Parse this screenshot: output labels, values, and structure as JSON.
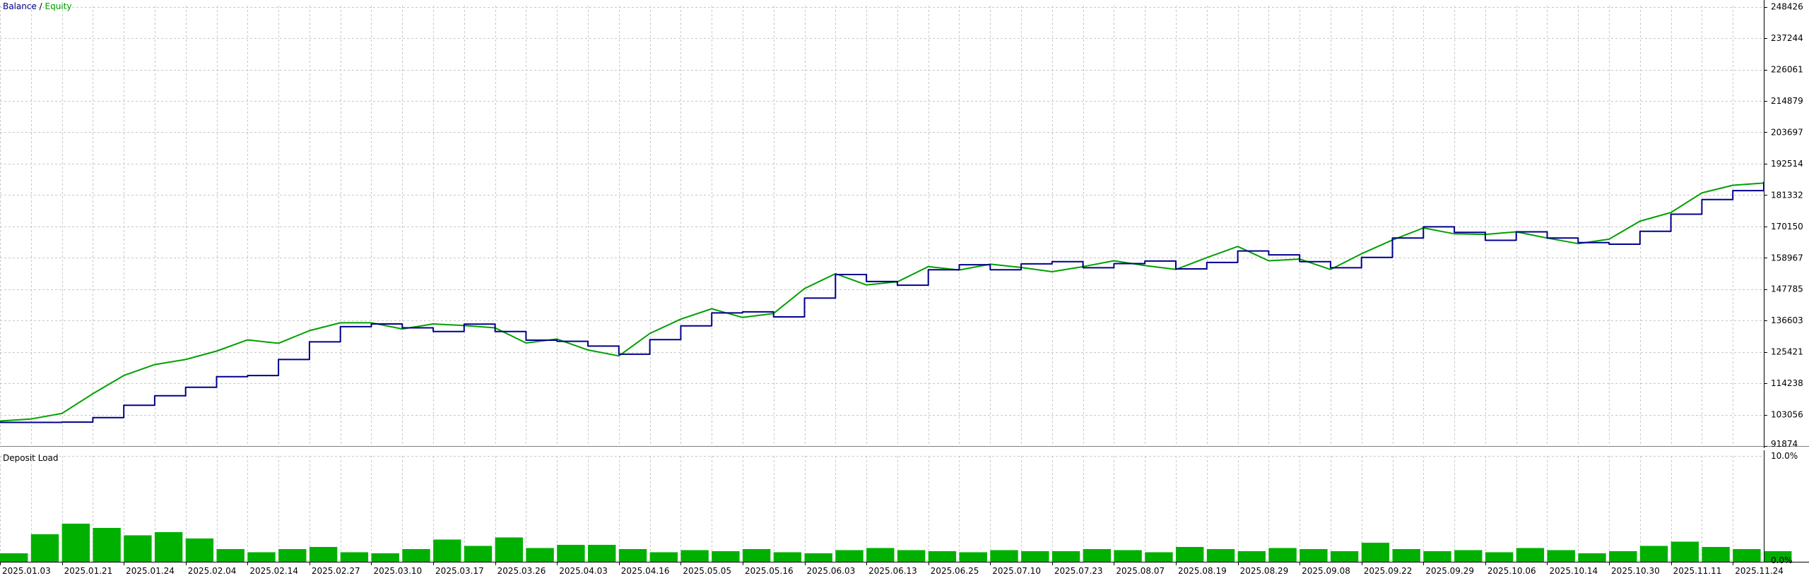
{
  "legend": {
    "balance": "Balance",
    "separator": " / ",
    "equity": "Equity"
  },
  "colors": {
    "balance": "#00008b",
    "equity": "#00a000",
    "grid": "#c8c8c8",
    "axis": "#000000",
    "load": "#00b000"
  },
  "chart_data": [
    {
      "type": "line",
      "title": "",
      "xlabel": "",
      "ylabel": "",
      "grid": true,
      "legend_placement": "top-left",
      "ylim": [
        91874,
        248825
      ],
      "y_ticks": [
        91874,
        103056,
        114238,
        125421,
        136603,
        147785,
        158967,
        170150,
        181332,
        192514,
        203697,
        214879,
        226061,
        237244,
        248426
      ],
      "x_labels": [
        "2025.01.03",
        "2025.01.21",
        "2025.01.24",
        "2025.02.04",
        "2025.02.14",
        "2025.02.27",
        "2025.03.10",
        "2025.03.17",
        "2025.03.26",
        "2025.04.03",
        "2025.04.16",
        "2025.05.05",
        "2025.05.16",
        "2025.06.03",
        "2025.06.13",
        "2025.06.25",
        "2025.07.10",
        "2025.07.23",
        "2025.08.07",
        "2025.08.19",
        "2025.08.29",
        "2025.09.08",
        "2025.09.22",
        "2025.09.29",
        "2025.10.06",
        "2025.10.14",
        "2025.10.30",
        "2025.11.11",
        "2025.11.24"
      ],
      "series": [
        {
          "name": "Balance",
          "x": [
            0,
            0.5,
            1,
            1.5,
            2,
            2.5,
            3,
            3.5,
            4,
            4.5,
            5,
            5.5,
            6,
            6.5,
            7,
            7.5,
            8,
            8.5,
            9,
            9.5,
            10,
            10.5,
            11,
            11.5,
            12,
            12.5,
            13,
            13.5,
            14,
            14.5,
            15,
            15.5,
            16,
            16.5,
            17,
            17.5,
            18,
            18.5,
            19,
            19.5,
            20,
            20.5,
            21,
            21.5,
            22,
            22.5,
            23,
            23.5,
            24,
            24.5,
            25,
            25.5,
            26,
            26.5,
            27,
            27.5,
            28,
            28.5
          ],
          "values": [
            100300,
            100300,
            100400,
            102000,
            106400,
            109800,
            112800,
            116600,
            117000,
            122700,
            129000,
            134400,
            135400,
            134000,
            132700,
            135300,
            132700,
            129600,
            129200,
            127500,
            124600,
            129800,
            134700,
            139300,
            139700,
            137900,
            144600,
            153000,
            150500,
            149200,
            154700,
            156500,
            154700,
            156800,
            157600,
            155400,
            156900,
            157800,
            155000,
            157300,
            161400,
            160000,
            157600,
            155400,
            159100,
            166000,
            170000,
            168000,
            165200,
            168200,
            166000,
            164400,
            163800,
            168400,
            174500,
            179700,
            182900,
            186000
          ]
        },
        {
          "name": "Equity",
          "x": [
            0,
            0.5,
            1,
            1.5,
            2,
            2.5,
            3,
            3.5,
            4,
            4.5,
            5,
            5.5,
            6,
            6.5,
            7,
            7.5,
            8,
            8.5,
            9,
            9.5,
            10,
            10.5,
            11,
            11.5,
            12,
            12.5,
            13,
            13.5,
            14,
            14.5,
            15,
            15.5,
            16,
            16.5,
            17,
            17.5,
            18,
            18.5,
            19,
            19.5,
            20,
            20.5,
            21,
            21.5,
            22,
            22.5,
            23,
            23.5,
            24,
            24.5,
            25,
            25.5,
            26,
            26.5,
            27,
            27.5,
            28,
            28.5
          ],
          "values": [
            100800,
            101500,
            103500,
            110500,
            117000,
            120900,
            122700,
            125700,
            129700,
            128500,
            133000,
            135800,
            135800,
            133600,
            135400,
            134800,
            134000,
            128600,
            130000,
            126100,
            124000,
            132000,
            137100,
            140800,
            137700,
            139100,
            148000,
            153300,
            149300,
            150400,
            155800,
            154600,
            156700,
            155500,
            154000,
            155800,
            157900,
            156200,
            154800,
            159000,
            163000,
            157900,
            158500,
            154800,
            160400,
            165300,
            169600,
            167500,
            167300,
            168200,
            166000,
            164000,
            165600,
            172000,
            175100,
            182100,
            184800,
            185600
          ]
        }
      ]
    },
    {
      "type": "bar",
      "title": "Deposit Load",
      "xlabel": "",
      "ylabel": "",
      "ylim": [
        0,
        10
      ],
      "y_ticks": [
        "0.0%",
        "10.0%"
      ],
      "x": [
        0,
        0.5,
        1,
        1.5,
        2,
        2.5,
        3,
        3.5,
        4,
        4.5,
        5,
        5.5,
        6,
        6.5,
        7,
        7.5,
        8,
        8.5,
        9,
        9.5,
        10,
        10.5,
        11,
        11.5,
        12,
        12.5,
        13,
        13.5,
        14,
        14.5,
        15,
        15.5,
        16,
        16.5,
        17,
        17.5,
        18,
        18.5,
        19,
        19.5,
        20,
        20.5,
        21,
        21.5,
        22,
        22.5,
        23,
        23.5,
        24,
        24.5,
        25,
        25.5,
        26,
        26.5,
        27,
        27.5,
        28,
        28.5
      ],
      "values": [
        0.8,
        2.6,
        3.6,
        3.2,
        2.5,
        2.8,
        2.2,
        1.2,
        0.9,
        1.2,
        1.4,
        0.9,
        0.8,
        1.2,
        2.1,
        1.5,
        2.3,
        1.3,
        1.6,
        1.6,
        1.2,
        0.9,
        1.1,
        1.0,
        1.2,
        0.9,
        0.8,
        1.1,
        1.3,
        1.1,
        1.0,
        0.9,
        1.1,
        1.0,
        1.0,
        1.2,
        1.1,
        0.9,
        1.4,
        1.2,
        1.0,
        1.3,
        1.2,
        1.0,
        1.8,
        1.2,
        1.0,
        1.1,
        0.9,
        1.3,
        1.1,
        0.8,
        1.0,
        1.5,
        1.9,
        1.4,
        1.2,
        1.0
      ]
    }
  ]
}
